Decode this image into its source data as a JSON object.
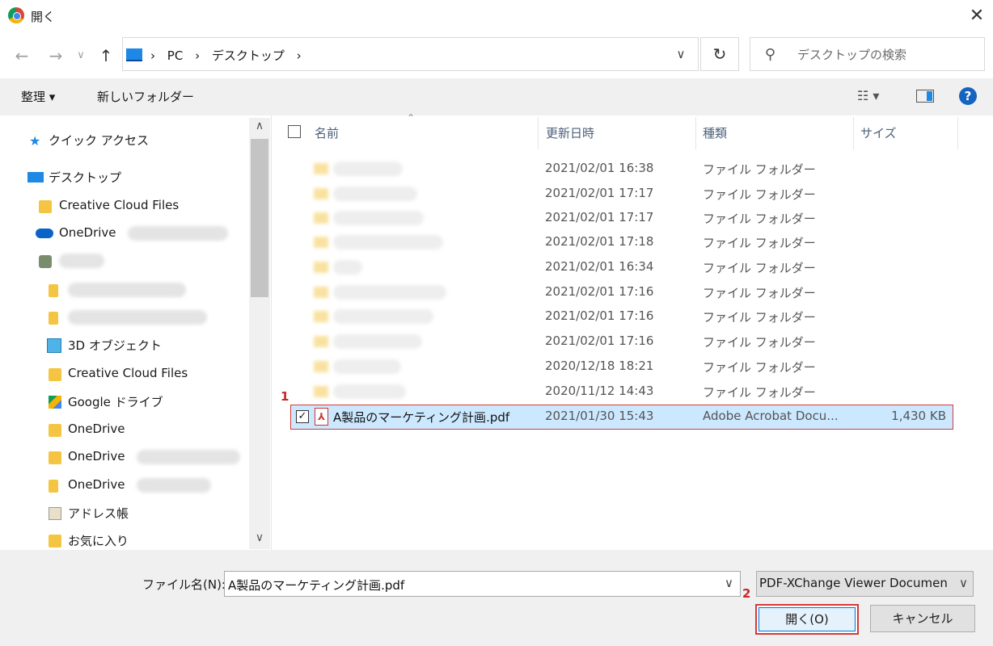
{
  "window": {
    "title": "開く",
    "close_glyph": "✕"
  },
  "nav": {
    "back": "←",
    "forward": "→",
    "recent": "∨",
    "up": "↑",
    "path": [
      "PC",
      "デスクトップ"
    ],
    "refresh": "↻",
    "search_placeholder": "デスクトップの検索"
  },
  "toolbar": {
    "organize": "整理 ▾",
    "new_folder": "新しいフォルダー",
    "view": "☷ ▾"
  },
  "sidebar": {
    "quick_access": "クイック アクセス",
    "desktop": "デスクトップ",
    "items": [
      "Creative Cloud Files",
      "OneDrive",
      "3D オブジェクト",
      "Creative Cloud Files",
      "Google ドライブ",
      "OneDrive",
      "OneDrive",
      "OneDrive",
      "アドレス帳",
      "お気に入り"
    ]
  },
  "columns": {
    "name": "名前",
    "date": "更新日時",
    "type": "種類",
    "size": "サイズ"
  },
  "files": [
    {
      "date": "2021/02/01 16:38",
      "type": "ファイル フォルダー"
    },
    {
      "date": "2021/02/01 17:17",
      "type": "ファイル フォルダー"
    },
    {
      "date": "2021/02/01 17:17",
      "type": "ファイル フォルダー"
    },
    {
      "date": "2021/02/01 17:18",
      "type": "ファイル フォルダー"
    },
    {
      "date": "2021/02/01 16:34",
      "type": "ファイル フォルダー"
    },
    {
      "date": "2021/02/01 17:16",
      "type": "ファイル フォルダー"
    },
    {
      "date": "2021/02/01 17:16",
      "type": "ファイル フォルダー"
    },
    {
      "date": "2021/02/01 17:16",
      "type": "ファイル フォルダー"
    },
    {
      "date": "2020/12/18 18:21",
      "type": "ファイル フォルダー"
    },
    {
      "date": "2020/11/12 14:43",
      "type": "ファイル フォルダー"
    }
  ],
  "selected_file": {
    "name": "A製品のマーケティング計画.pdf",
    "date": "2021/01/30 15:43",
    "type": "Adobe Acrobat Docu...",
    "size": "1,430 KB"
  },
  "markers": {
    "one": "1",
    "two": "2"
  },
  "bottom": {
    "filename_label": "ファイル名(N):",
    "filename_value": "A製品のマーケティング計画.pdf",
    "file_type": "PDF-XChange Viewer Documen",
    "open": "開く(O)",
    "cancel": "キャンセル"
  }
}
